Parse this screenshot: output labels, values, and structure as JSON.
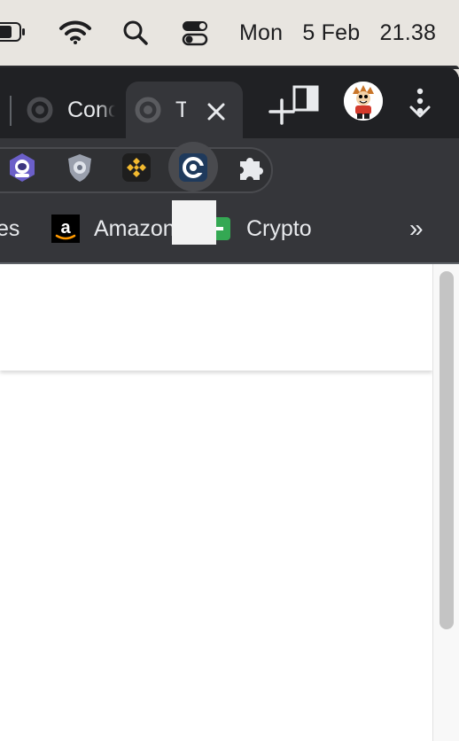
{
  "menubar": {
    "day": "Mon",
    "date": "5 Feb",
    "time": "21.38",
    "icons": [
      "battery-icon",
      "wifi-icon",
      "spotlight-search-icon",
      "control-center-icon"
    ]
  },
  "tabs": [
    {
      "title": "Conc",
      "active": false,
      "icon": "tab-favicon"
    },
    {
      "title": "T",
      "active": true,
      "icon": "tab-favicon"
    }
  ],
  "toolbar": {
    "extensions": [
      "astronaut-extension-icon",
      "shield-extension-icon",
      "binance-extension-icon",
      "at-sign-extension-icon",
      "extensions-puzzle-icon"
    ],
    "profile": "profile-avatar",
    "menu": "more-options-icon"
  },
  "bookmarks": [
    {
      "label": "es",
      "icon": ""
    },
    {
      "label": "Amazon",
      "icon": "amazon-icon"
    },
    {
      "label": "Crypto",
      "icon": "folder-icon"
    }
  ],
  "bookmarks_overflow": "»",
  "colors": {
    "tabstrip": "#202124",
    "toolbar": "#35363a",
    "text": "#e8eaed",
    "menubar": "#e8e5e0"
  }
}
